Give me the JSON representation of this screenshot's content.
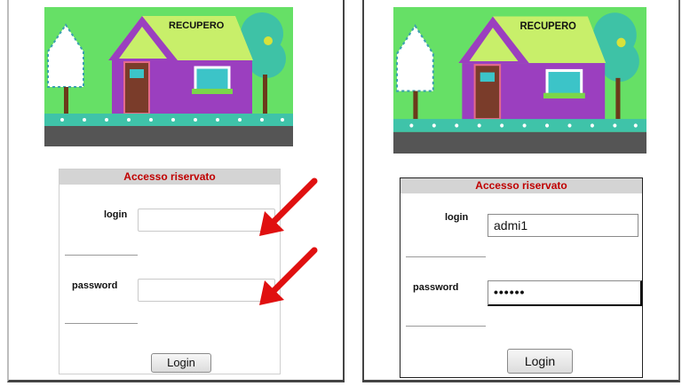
{
  "scene": {
    "sign_text": "RECUPERO"
  },
  "left": {
    "header": "Accesso riservato",
    "login_label": "login",
    "login_value": "",
    "password_label": "password",
    "password_value": "",
    "button_label": "Login"
  },
  "right": {
    "header": "Accesso riservato",
    "login_label": "login",
    "login_value": "admi1",
    "password_label": "password",
    "password_value": "••••••",
    "button_label": "Login"
  },
  "colors": {
    "header_text": "#c00000",
    "header_bg": "#d4d4d4",
    "arrow": "#e01010",
    "sky": "#66e066",
    "roof": "#9be37a",
    "wall": "#9b3fbf",
    "ground": "#555555"
  }
}
